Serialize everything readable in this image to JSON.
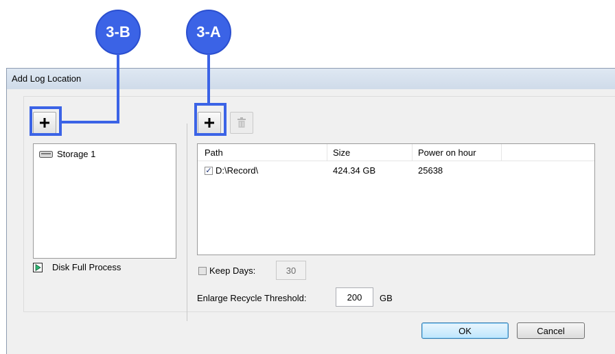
{
  "callouts": {
    "b": "3-B",
    "a": "3-A"
  },
  "window": {
    "title": "Add Log Location"
  },
  "left_panel": {
    "add_button_icon": "plus-icon",
    "storage_items": [
      {
        "label": "Storage 1",
        "icon": "drive-icon"
      }
    ],
    "disk_full_process_label": "Disk Full Process"
  },
  "right_panel": {
    "add_button_icon": "plus-icon",
    "delete_button_icon": "trash-icon",
    "columns": [
      "Path",
      "Size",
      "Power on hour"
    ],
    "rows": [
      {
        "checked": true,
        "path": "D:\\Record\\",
        "size": "424.34 GB",
        "power_on_hour": "25638"
      }
    ],
    "keep_days": {
      "label": "Keep Days:",
      "checked": false,
      "value": "30"
    },
    "recycle": {
      "label": "Enlarge Recycle Threshold:",
      "value": "200",
      "unit": "GB"
    }
  },
  "buttons": {
    "ok": "OK",
    "cancel": "Cancel"
  },
  "colors": {
    "callout": "#3b63e6"
  }
}
